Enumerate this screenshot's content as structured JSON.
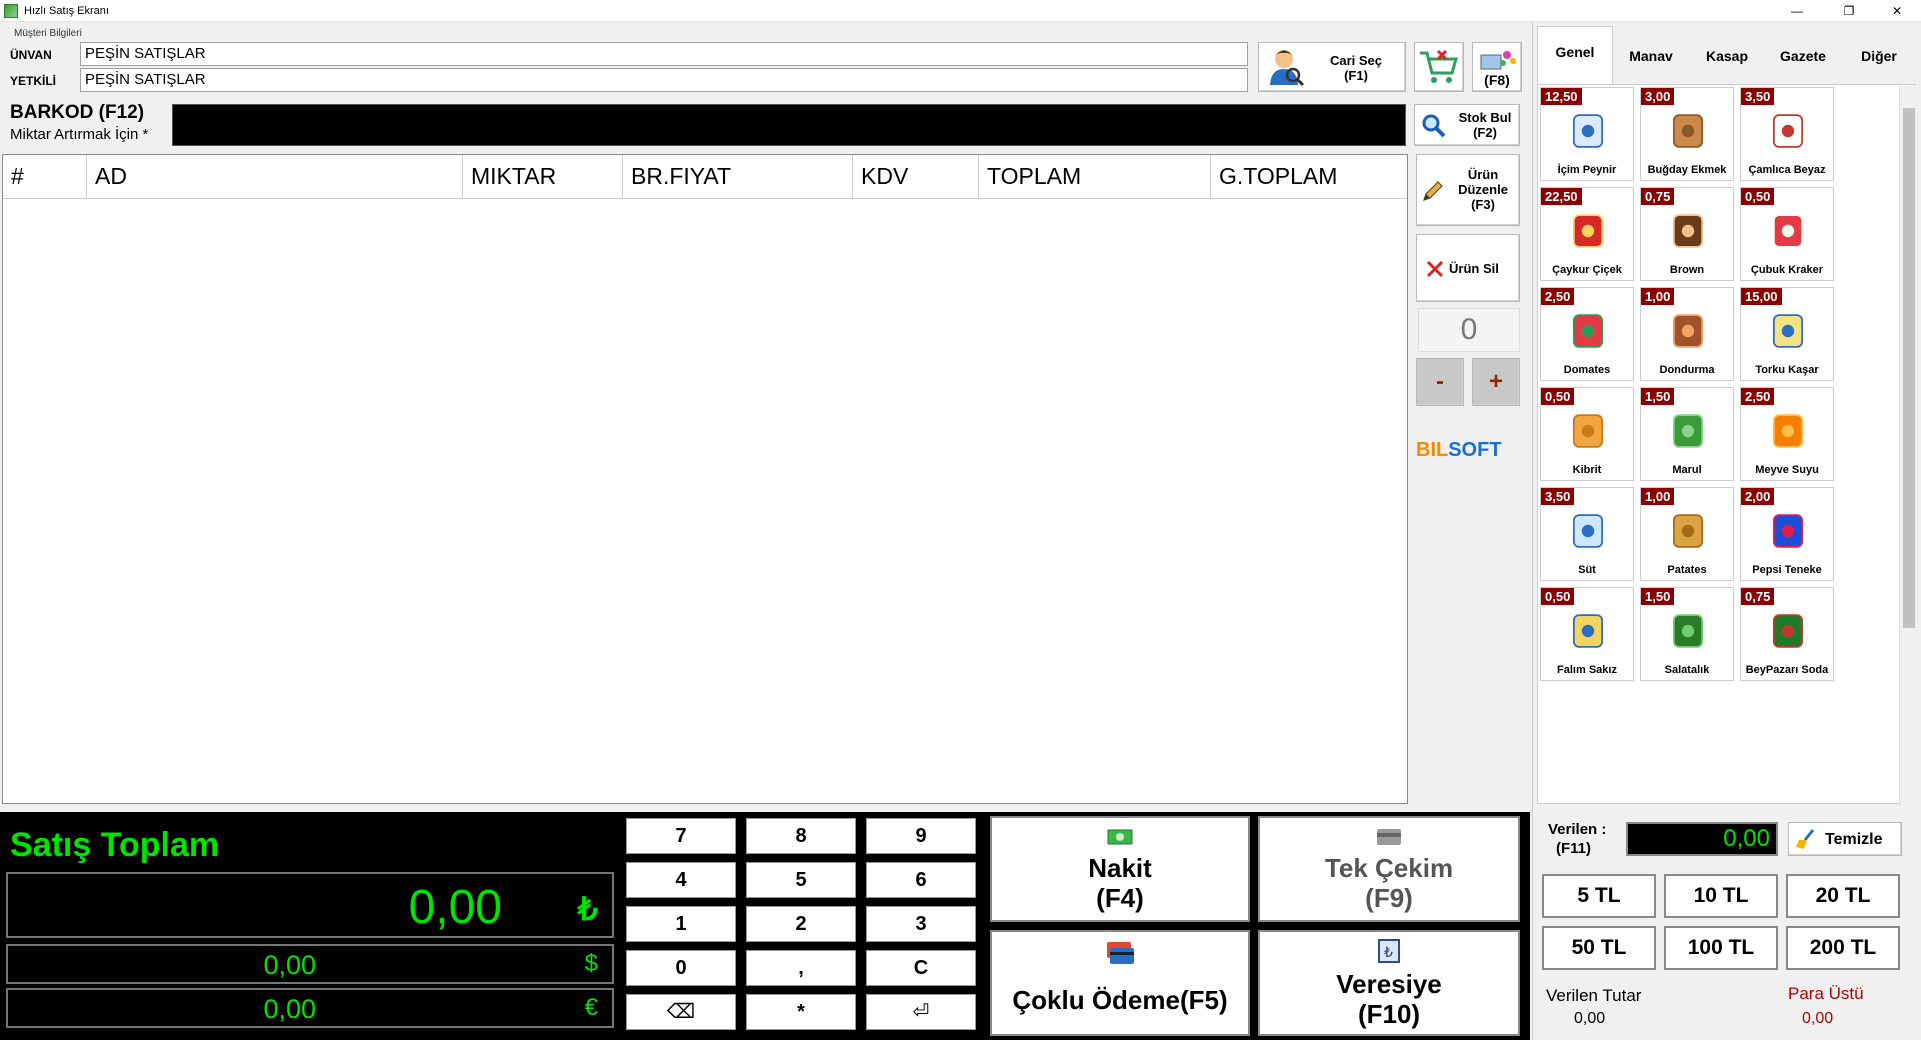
{
  "window": {
    "title": "Hızlı Satış Ekranı",
    "minimize": "—",
    "restore": "❐",
    "close": "✕"
  },
  "customer": {
    "group_label": "Müşteri Bilgileri",
    "unvan_label": "ÜNVAN",
    "unvan_value": "PEŞİN SATIŞLAR",
    "yetkili_label": "YETKİLİ",
    "yetkili_value": "PEŞİN SATIŞLAR",
    "cari_sec": "Cari Seç",
    "cari_sec_key": "(F1)",
    "f8_label": "(F8)"
  },
  "barcode": {
    "label": "BARKOD (F12)",
    "sub": "Miktar Artırmak İçin *",
    "value": ""
  },
  "grid": {
    "columns": [
      "#",
      "AD",
      "MIKTAR",
      "BR.FIYAT",
      "KDV",
      "TOPLAM",
      "G.TOPLAM"
    ]
  },
  "side": {
    "stok_bul": "Stok Bul",
    "stok_bul_key": "(F2)",
    "urun_duzenle_1": "Ürün",
    "urun_duzenle_2": "Düzenle",
    "urun_duzenle_key": "(F3)",
    "urun_sil": "Ürün Sil",
    "qty": "0",
    "minus": "-",
    "plus": "+",
    "logo_a": "BIL",
    "logo_b": "SOFT"
  },
  "totals": {
    "title": "Satış Toplam",
    "try_value": "0,00",
    "try_symbol": "₺",
    "usd_value": "0,00",
    "usd_symbol": "$",
    "eur_value": "0,00",
    "eur_symbol": "€"
  },
  "keypad": [
    "7",
    "8",
    "9",
    "4",
    "5",
    "6",
    "1",
    "2",
    "3",
    "0",
    ",",
    "C",
    "⌫",
    "*",
    "⏎"
  ],
  "payment": {
    "nakit": "Nakit",
    "nakit_key": "(F4)",
    "tek_cekim": "Tek Çekim",
    "tek_cekim_key": "(F9)",
    "coklu": "Çoklu Ödeme(F5)",
    "veresiye": "Veresiye",
    "veresiye_key": "(F10)"
  },
  "tabs": [
    "Genel",
    "Manav",
    "Kasap",
    "Gazete",
    "Diğer"
  ],
  "products": [
    {
      "price": "12,50",
      "name": "İçim Peynir"
    },
    {
      "price": "3,00",
      "name": "Buğday Ekmek"
    },
    {
      "price": "3,50",
      "name": "Çamlıca Beyaz"
    },
    {
      "price": "22,50",
      "name": "Çaykur Çiçek"
    },
    {
      "price": "0,75",
      "name": "Brown"
    },
    {
      "price": "0,50",
      "name": "Çubuk Kraker"
    },
    {
      "price": "2,50",
      "name": "Domates"
    },
    {
      "price": "1,00",
      "name": "Dondurma"
    },
    {
      "price": "15,00",
      "name": "Torku Kaşar"
    },
    {
      "price": "0,50",
      "name": "Kibrit"
    },
    {
      "price": "1,50",
      "name": "Marul"
    },
    {
      "price": "2,50",
      "name": "Meyve Suyu"
    },
    {
      "price": "3,50",
      "name": "Süt"
    },
    {
      "price": "1,00",
      "name": "Patates"
    },
    {
      "price": "2,00",
      "name": "Pepsi Teneke"
    },
    {
      "price": "0,50",
      "name": "Falım Sakız"
    },
    {
      "price": "1,50",
      "name": "Salatalık"
    },
    {
      "price": "0,75",
      "name": "BeyPazarı Soda"
    }
  ],
  "change": {
    "verilen_label": "Verilen :",
    "verilen_key": "(F11)",
    "verilen_value": "0,00",
    "temizle": "Temizle",
    "bills": [
      "5 TL",
      "10 TL",
      "20 TL",
      "50 TL",
      "100 TL",
      "200 TL"
    ],
    "verilen_tutar_label": "Verilen Tutar",
    "verilen_tutar_value": "0,00",
    "para_ustu_label": "Para Üstü",
    "para_ustu_value": "0,00"
  },
  "colors": {
    "accent_green": "#00e400",
    "price_badge": "#8b0000",
    "logo_blue": "#1a6fd0",
    "logo_orange": "#f28c00"
  }
}
